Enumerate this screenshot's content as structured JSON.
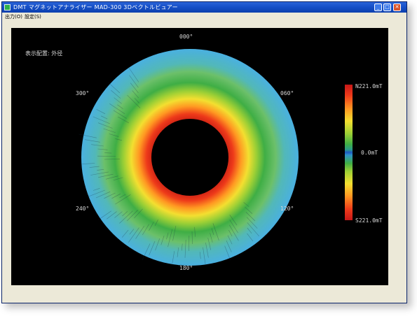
{
  "window": {
    "title": "DMT マグネットアナライザー MAD-300 3Dベクトルビュアー",
    "controls": {
      "minimize": "_",
      "maximize": "□",
      "close": "✕"
    }
  },
  "menu": {
    "items": [
      "出力(O)",
      "設定(S)"
    ]
  },
  "viewer": {
    "display_mode_label": "表示配置: 外径",
    "angle_labels": {
      "a0": "000°",
      "a60": "060°",
      "a120": "120°",
      "a180": "180°",
      "a240": "240°",
      "a300": "300°"
    },
    "scale": {
      "max": "N221.0mT",
      "mid": "0.0mT",
      "min": "S221.0mT"
    }
  },
  "colors": {
    "title_bar": "#0b3fae",
    "window_face": "#ece9d8",
    "viewer_bg": "#000000",
    "field_high": "#c81818",
    "field_mid": "#3fae45",
    "field_low": "#4ab0e0"
  }
}
